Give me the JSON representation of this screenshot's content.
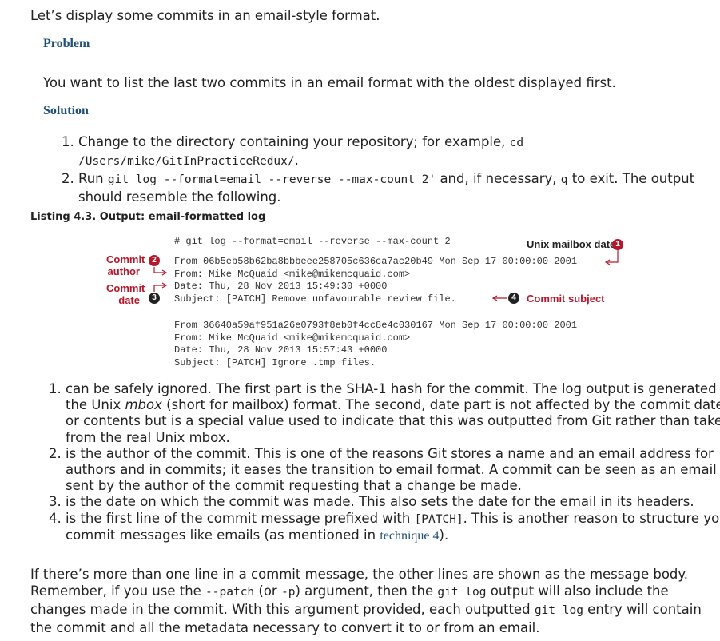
{
  "intro": "Let’s display some commits in an email-style format.",
  "problem": {
    "heading": "Problem",
    "text": "You want to list the last two commits in an email format with the oldest displayed first."
  },
  "solution": {
    "heading": "Solution",
    "step1_text": "Change to the directory containing your repository; for example, ",
    "step1_code_a": "cd",
    "step1_code_b": "/Users/mike/GitInPracticeRedux/",
    "step1_end": ".",
    "step2_a": "Run ",
    "step2_code": "git log --format=email --reverse --max-count 2'",
    "step2_b": " and, if necessary, ",
    "step2_q": "q",
    "step2_c": " to exit. The output should resemble the following."
  },
  "listing": {
    "title": "Listing 4.3. Output: email-formatted log",
    "command": "# git log --format=email --reverse --max-count 2",
    "commit1": [
      "From 06b5eb58b62ba8bbbeee258705c636ca7ac20b49 Mon Sep 17 00:00:00 2001",
      "From: Mike McQuaid <mike@mikemcquaid.com>",
      "Date: Thu, 28 Nov 2013 15:49:30 +0000",
      "Subject: [PATCH] Remove unfavourable review file."
    ],
    "commit2": [
      "From 36640a59af951a26e0793f8eb0f4cc8e4c030167 Mon Sep 17 00:00:00 2001",
      "From: Mike McQuaid <mike@mikemcquaid.com>",
      "Date: Thu, 28 Nov 2013 15:57:43 +0000",
      "Subject: [PATCH] Ignore .tmp files."
    ],
    "annotations": {
      "unix_mailbox_date": "Unix mailbox date",
      "commit_author_1": "Commit",
      "commit_author_2": "author",
      "commit_date_1": "Commit",
      "commit_date_2": "date",
      "commit_subject": "Commit subject",
      "n1": "1",
      "n2": "2",
      "n3": "3",
      "n4": "4"
    }
  },
  "notes": {
    "n1_a": "can be safely ignored. The first part is the SHA-1 hash for the commit. The log output is generated in the Unix ",
    "n1_em": "mbox",
    "n1_b": " (short for mailbox) format. The second, date part is not affected by the commit date or contents but is a special value used to indicate that this was outputted from Git rather than taken from the real Unix mbox.",
    "n2": "is the author of the commit. This is one of the reasons Git stores a name and an email address for authors and in commits; it eases the transition to email format. A commit can be seen as an email sent by the author of the commit requesting that a change be made.",
    "n3": "is the date on which the commit was made. This also sets the date for the email in its headers.",
    "n4_a": "is the first line of the commit message prefixed with ",
    "n4_code": "[PATCH]",
    "n4_b": ". This is another reason to structure your commit messages like emails (as mentioned in ",
    "n4_link": "technique 4",
    "n4_c": ")."
  },
  "final": {
    "a": "If there’s more than one line in a commit message, the other lines are shown as the message body. Remember, if you use the ",
    "code1": "--patch",
    "b": " (or ",
    "code2": "-p",
    "c": ") argument, then the ",
    "code3": "git log",
    "d": " output will also include the changes made in the commit. With this argument provided, each outputted ",
    "code4": "git log",
    "e": " entry will contain the commit and all the metadata necessary to convert it to or from an email."
  },
  "colors": {
    "heading": "#1e4f78",
    "annotation_red": "#b5182b",
    "link": "#1e4f78"
  }
}
